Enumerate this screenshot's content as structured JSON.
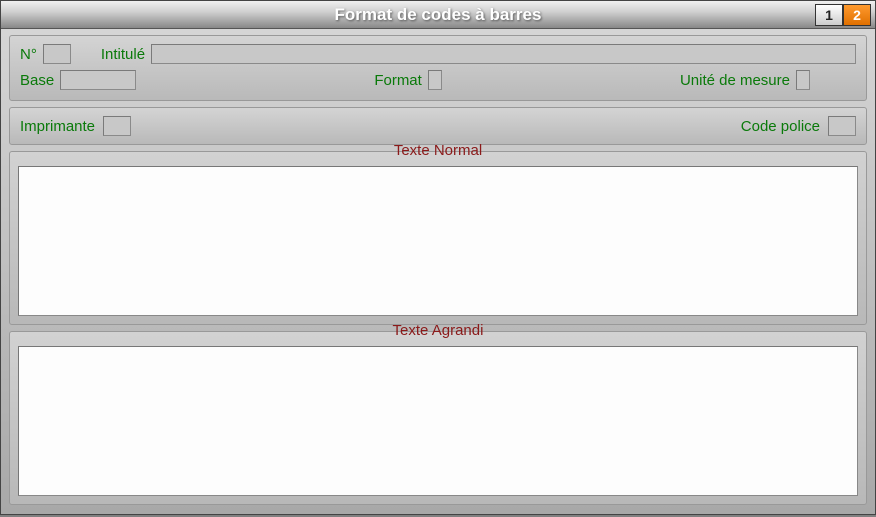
{
  "window": {
    "title": "Format de codes à barres"
  },
  "tabs": {
    "one": "1",
    "two": "2"
  },
  "form": {
    "num_label": "N°",
    "num_value": "",
    "intitule_label": "Intitulé",
    "intitule_value": "",
    "base_label": "Base",
    "base_value": "",
    "format_label": "Format",
    "format_value": "",
    "unite_label": "Unité de mesure",
    "unite_value": ""
  },
  "printer": {
    "imprimante_label": "Imprimante",
    "imprimante_value": "",
    "codepolice_label": "Code police",
    "codepolice_value": ""
  },
  "textareas": {
    "normal_legend": "Texte Normal",
    "normal_value": "",
    "agrandi_legend": "Texte Agrandi",
    "agrandi_value": ""
  }
}
